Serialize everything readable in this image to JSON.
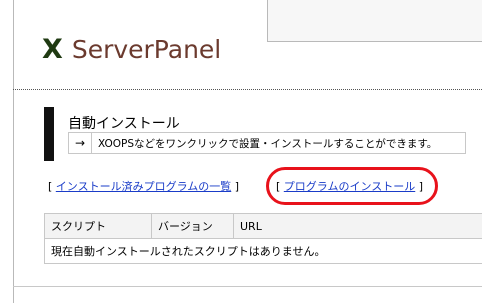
{
  "header": {
    "logo_mark": "X",
    "logo_text": "ServerPanel"
  },
  "section": {
    "title": "自動インストール",
    "description_arrow": "→",
    "description": "XOOPSなどをワンクリックで設置・インストールすることができます。"
  },
  "links": {
    "installed_list": {
      "open_bracket": "[ ",
      "label": "インストール済みプログラムの一覧",
      "close_bracket": " ]"
    },
    "program_install": {
      "open_bracket": "[ ",
      "label": "プログラムのインストール",
      "close_bracket": " ]"
    },
    "highlight_color": "#e8121b",
    "link_color": "#1a3cc8"
  },
  "table": {
    "columns": [
      "スクリプト",
      "バージョン",
      "URL"
    ],
    "empty_message": "現在自動インストールされたスクリプトはありません。"
  }
}
